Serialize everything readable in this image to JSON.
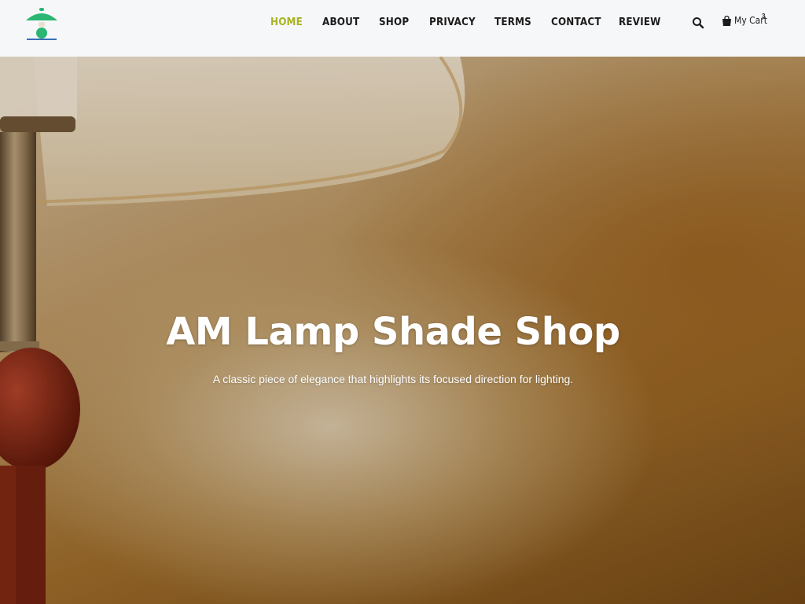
{
  "header": {
    "logo_icon": "lamp-logo-icon",
    "nav": [
      {
        "label": "HOME",
        "active": true
      },
      {
        "label": "ABOUT",
        "active": false
      },
      {
        "label": "SHOP",
        "active": false
      },
      {
        "label": "PRIVACY",
        "active": false
      },
      {
        "label": "TERMS",
        "active": false
      },
      {
        "label": "CONTACT",
        "active": false
      },
      {
        "label": "REVIEW",
        "active": false
      }
    ],
    "search_icon": "search-icon",
    "cart": {
      "label": "My Cart",
      "count": "3",
      "icon": "shopping-bag-icon"
    }
  },
  "hero": {
    "title": "AM Lamp Shade Shop",
    "subtitle": "A classic piece of elegance that highlights its focused direction for lighting."
  },
  "colors": {
    "active_nav": "#a8b224",
    "logo_green": "#2bb673",
    "logo_blue": "#3b6fb6",
    "header_bg": "#f6f7f9"
  }
}
